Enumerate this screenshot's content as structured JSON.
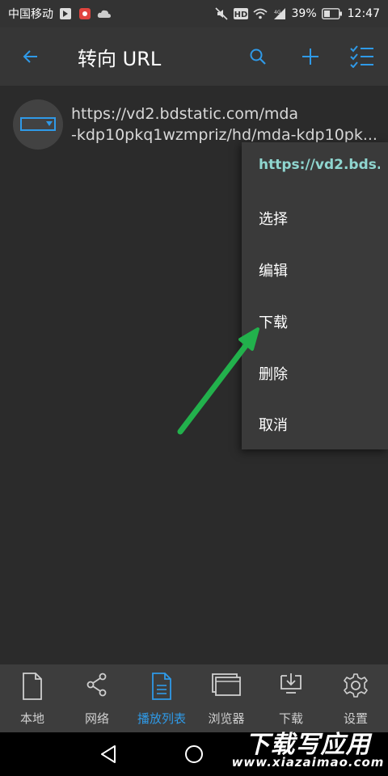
{
  "status_bar": {
    "carrier": "中国移动",
    "battery": "39%",
    "time": "12:47",
    "icons": [
      "arrow-app-icon",
      "red-app-icon",
      "cloud-icon",
      "mute-icon",
      "hd-icon",
      "wifi-icon",
      "signal-4g-icon",
      "battery-icon"
    ]
  },
  "app_bar": {
    "title": "转向 URL",
    "actions": [
      "back-icon",
      "search-icon",
      "plus-icon",
      "checklist-icon"
    ],
    "accent": "#2f9ae8"
  },
  "list": {
    "items": [
      {
        "line1": "https://vd2.bdstatic.com/mda",
        "line2": "-kdp10pkq1wzmpriz/hd/mda-kdp10pk...",
        "icon": "video-file-icon"
      }
    ]
  },
  "context_menu": {
    "header": "https://vd2.bds..",
    "header_color": "#8fd6d0",
    "items": [
      "选择",
      "编辑",
      "下载",
      "删除",
      "取消"
    ]
  },
  "annotation": {
    "arrow_color": "#22b14c"
  },
  "bottom_nav": {
    "tabs": [
      {
        "label": "本地",
        "icon": "file-icon",
        "active": false
      },
      {
        "label": "网络",
        "icon": "share-icon",
        "active": false
      },
      {
        "label": "播放列表",
        "icon": "playlist-icon",
        "active": true
      },
      {
        "label": "浏览器",
        "icon": "browser-icon",
        "active": false
      },
      {
        "label": "下载",
        "icon": "download-icon",
        "active": false
      },
      {
        "label": "设置",
        "icon": "gear-icon",
        "active": false
      }
    ]
  },
  "system_nav": {
    "buttons": [
      "back-triangle-icon",
      "home-circle-icon"
    ]
  },
  "watermark": {
    "big": "下载写应用",
    "small": "www.xiazaimao.com"
  }
}
